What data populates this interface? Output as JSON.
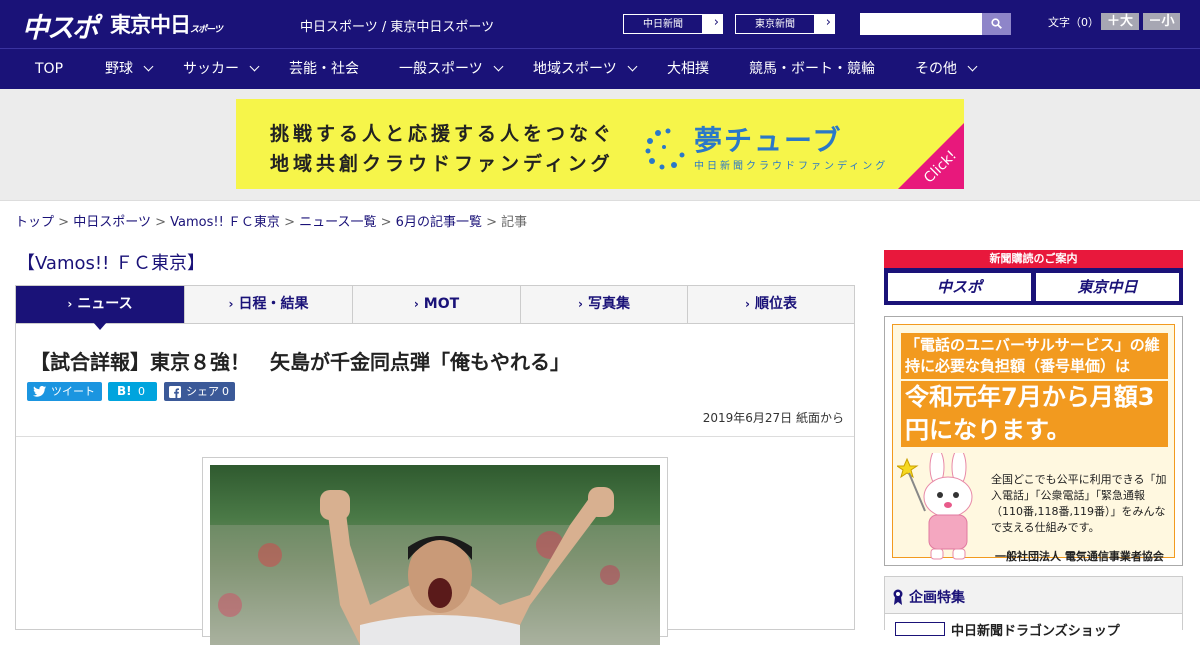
{
  "header": {
    "logo_primary": "中スポ",
    "logo_secondary": "東京中日",
    "logo_secondary_small": "スポーツ",
    "tagline": "中日スポーツ / 東京中日スポーツ",
    "paper_buttons": [
      "中日新聞",
      "東京新聞"
    ],
    "search": {
      "placeholder": "",
      "value": ""
    },
    "font_size_label": "文字（0）",
    "font_larger": "＋大",
    "font_smaller": "－小"
  },
  "nav": {
    "items": [
      {
        "label": "TOP",
        "dropdown": false
      },
      {
        "label": "野球",
        "dropdown": true
      },
      {
        "label": "サッカー",
        "dropdown": true
      },
      {
        "label": "芸能・社会",
        "dropdown": false
      },
      {
        "label": "一般スポーツ",
        "dropdown": true
      },
      {
        "label": "地域スポーツ",
        "dropdown": true
      },
      {
        "label": "大相撲",
        "dropdown": false
      },
      {
        "label": "競馬・ボート・競輪",
        "dropdown": false
      },
      {
        "label": "その他",
        "dropdown": true
      }
    ]
  },
  "banner": {
    "line1": "挑戦する人と応援する人をつなぐ",
    "line2": "地域共創クラウドファンディング",
    "brand": "夢チューブ",
    "brand_sub": "中日新聞クラウドファンディング",
    "click": "Click!"
  },
  "breadcrumb": {
    "items": [
      "トップ",
      "中日スポーツ",
      "Vamos!! ＦＣ東京",
      "ニュース一覧",
      "6月の記事一覧"
    ],
    "current": "記事",
    "separator": ">"
  },
  "section": {
    "title": "【Vamos!! ＦＣ東京】"
  },
  "tabs": {
    "items": [
      "ニュース",
      "日程・結果",
      "MOT",
      "写真集",
      "順位表"
    ],
    "active": 0
  },
  "article": {
    "headline": "【試合詳報】東京８強！　矢島が千金同点弾「俺もやれる」",
    "share": {
      "tweet_label": "ツイート",
      "hatena_label": "B!",
      "hatena_count": "0",
      "facebook_label": "シェア",
      "facebook_count": "0"
    },
    "date": "2019年6月27日 紙面から"
  },
  "sidebar": {
    "subscription": {
      "title": "新聞購読のご案内",
      "paper1": "中スポ",
      "paper2": "東京中日"
    },
    "notice": {
      "headline1": "「電話のユニバーサルサービス」の維持に必要な負担額（番号単価）は",
      "headline2": "令和元年7月から月額3円になります。",
      "body": "全国どこでも公平に利用できる「加入電話」「公衆電話」「緊急通報（110番,118番,119番）」をみんなで支える仕組みです。",
      "org": "一般社団法人 電気通信事業者協会"
    },
    "feature": {
      "title": "企画特集",
      "item": "中日新聞ドラゴンズショップ"
    }
  },
  "colors": {
    "brand_navy": "#1a1278",
    "banner_yellow": "#f6f54a",
    "accent_red": "#e8183c",
    "notice_orange": "#f29a1f"
  }
}
